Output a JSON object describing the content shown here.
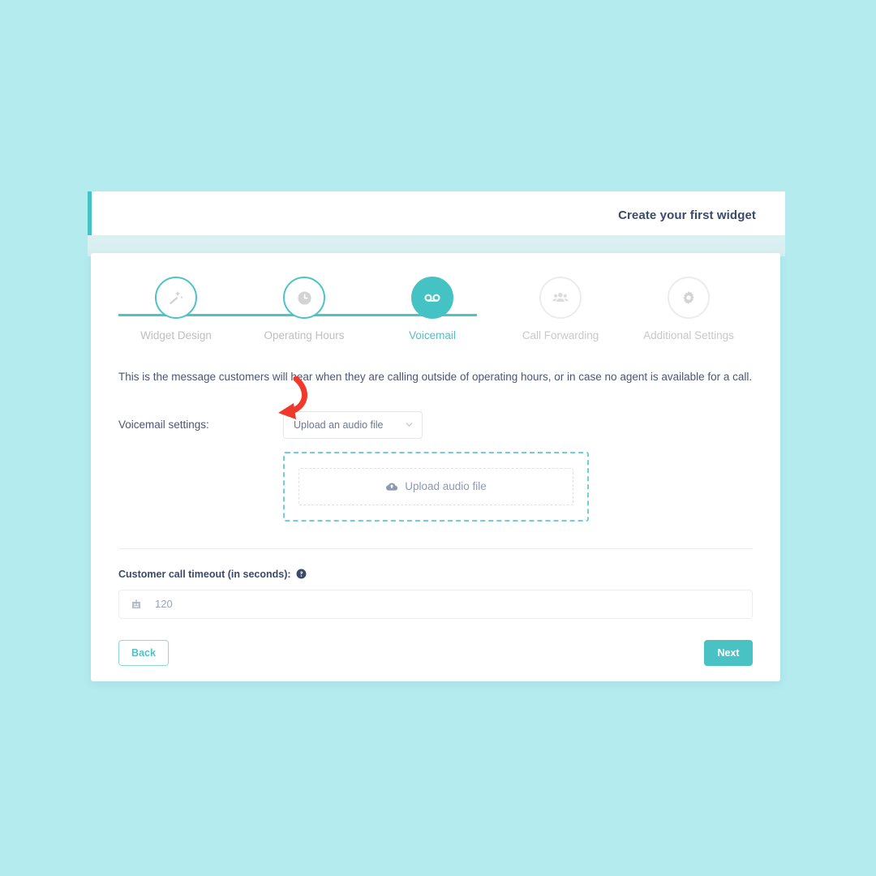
{
  "colors": {
    "page_background": "#b3ebee",
    "accent_teal": "#45c2c4",
    "text_navy": "#3b4a6b",
    "muted_gray": "#c9c9c9",
    "annotation_red": "#f0392b"
  },
  "header": {
    "title": "Create your first widget"
  },
  "stepper": {
    "steps": [
      {
        "label": "Widget Design",
        "icon": "magic-wand-icon",
        "state": "done"
      },
      {
        "label": "Operating Hours",
        "icon": "clock-icon",
        "state": "done"
      },
      {
        "label": "Voicemail",
        "icon": "voicemail-icon",
        "state": "active"
      },
      {
        "label": "Call Forwarding",
        "icon": "people-icon",
        "state": "upcoming"
      },
      {
        "label": "Additional Settings",
        "icon": "gear-icon",
        "state": "upcoming"
      }
    ]
  },
  "main": {
    "description": "This is the message customers will hear when they are calling outside of operating hours, or in case no agent is available for a call.",
    "settings_label": "Voicemail settings:",
    "voicemail_select": {
      "value": "Upload an audio file",
      "icon": "chevron-down-icon"
    },
    "upload": {
      "label": "Upload audio file",
      "icon": "cloud-upload-icon"
    },
    "timeout": {
      "label": "Customer call timeout (in seconds):",
      "help_icon": "help-circle-icon",
      "field_icon": "timer-icon",
      "value": "120"
    }
  },
  "footer": {
    "back_label": "Back",
    "next_label": "Next"
  },
  "annotation": {
    "arrow": "curved-arrow-pointing-to-voicemail-select"
  }
}
